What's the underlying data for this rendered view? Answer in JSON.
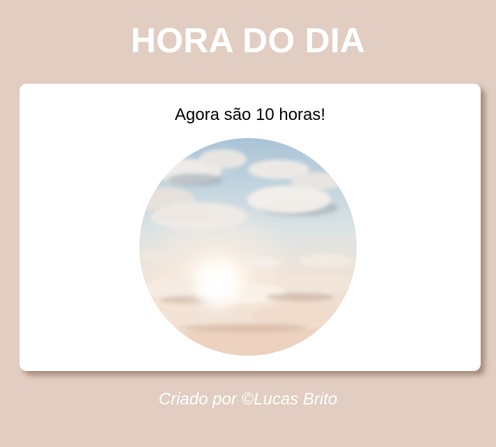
{
  "header": {
    "title": "HORA DO DIA"
  },
  "card": {
    "message": "Agora são 10 horas!",
    "image": {
      "subject": "morning-sky-clouds"
    }
  },
  "footer": {
    "credit": "Criado por ©Lucas Brito"
  },
  "colors": {
    "background": "#e1cdc1",
    "card": "#ffffff",
    "title": "#ffffff",
    "message": "#000000",
    "footer": "#ffffff"
  }
}
